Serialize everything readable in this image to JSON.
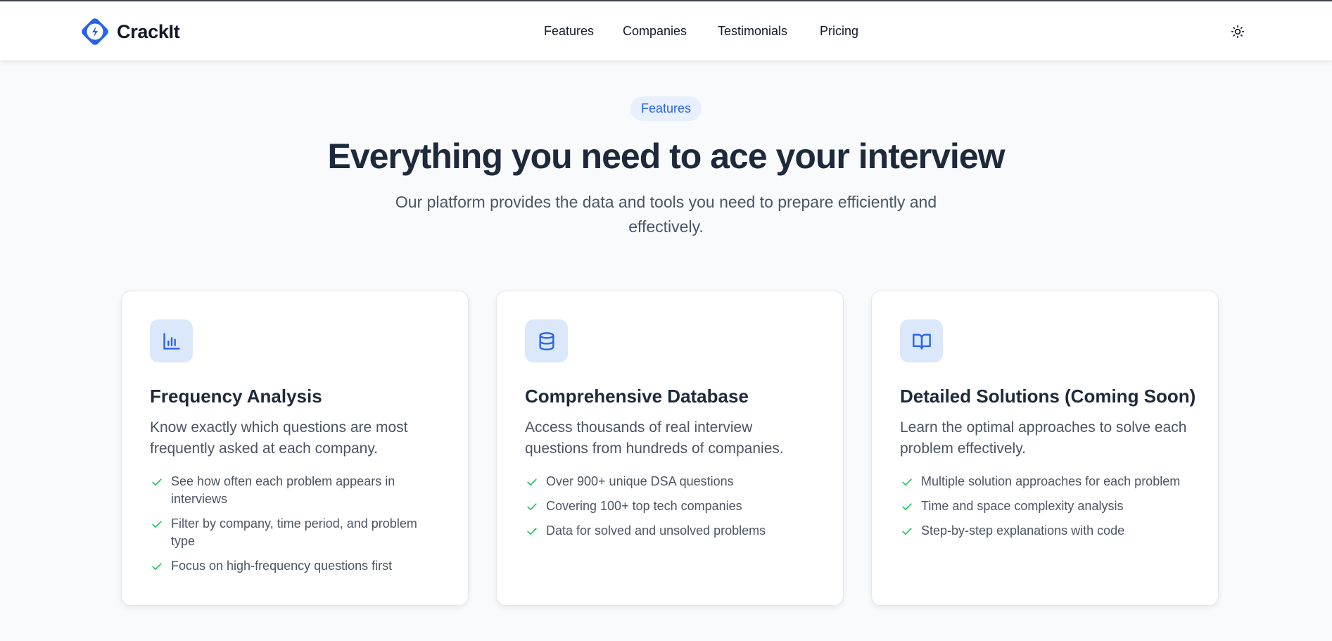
{
  "header": {
    "brand": "CrackIt",
    "nav": [
      "Features",
      "Companies",
      "Testimonials",
      "Pricing"
    ]
  },
  "hero": {
    "badge": "Features",
    "title": "Everything you need to ace your interview",
    "subtitle": "Our platform provides the data and tools you need to prepare efficiently and effectively."
  },
  "features": [
    {
      "icon": "bar-chart-icon",
      "title": "Frequency Analysis",
      "description": "Know exactly which questions are most frequently asked at each company.",
      "bullets": [
        "See how often each problem appears in interviews",
        "Filter by company, time period, and problem type",
        "Focus on high-frequency questions first"
      ]
    },
    {
      "icon": "database-icon",
      "title": "Comprehensive Database",
      "description": "Access thousands of real interview questions from hundreds of companies.",
      "bullets": [
        "Over 900+ unique DSA questions",
        "Covering 100+ top tech companies",
        "Data for solved and unsolved problems"
      ]
    },
    {
      "icon": "book-open-icon",
      "title": "Detailed Solutions (Coming Soon)",
      "description": "Learn the optimal approaches to solve each problem effectively.",
      "bullets": [
        "Multiple solution approaches for each problem",
        "Time and space complexity analysis",
        "Step-by-step explanations with code"
      ]
    }
  ],
  "colors": {
    "accent": "#2563eb",
    "check": "#22c55e",
    "heading": "#1e293b",
    "body": "#4b5563",
    "icon_bg": "#dbe7fb"
  }
}
